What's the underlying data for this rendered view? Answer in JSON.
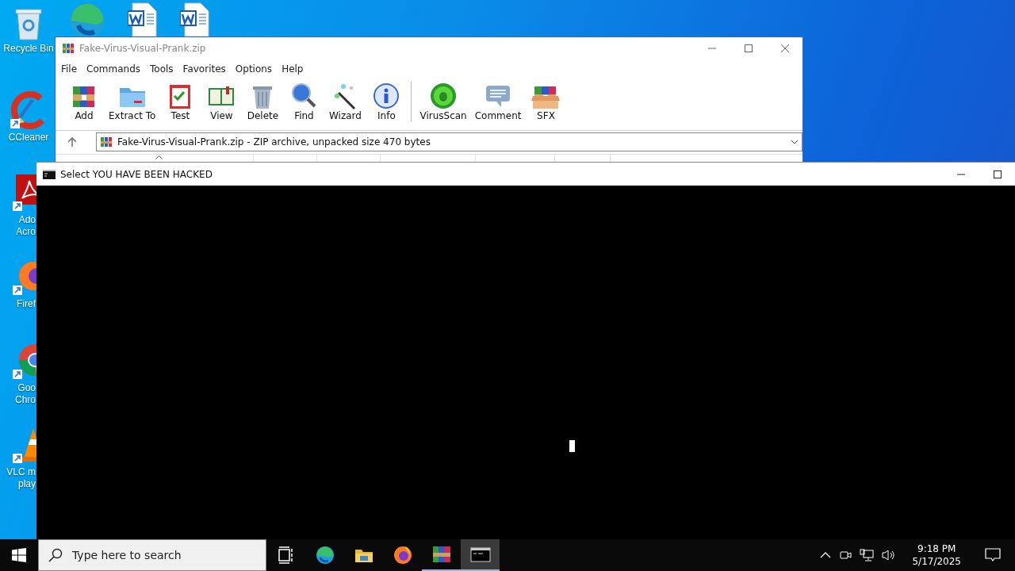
{
  "desktop_icons": [
    {
      "kind": "recycle",
      "lines": [
        "Recycle Bin"
      ]
    },
    {
      "kind": "ccleaner",
      "lines": [
        "CCleaner"
      ]
    },
    {
      "kind": "acrobat",
      "lines": [
        "Ado",
        "Acro"
      ]
    },
    {
      "kind": "firefox",
      "lines": [
        "Firef"
      ]
    },
    {
      "kind": "chrome",
      "lines": [
        "Goo",
        "Chro"
      ]
    },
    {
      "kind": "vlc",
      "lines": [
        "VLC m",
        "play"
      ]
    }
  ],
  "top_icons": [
    {
      "kind": "edge"
    },
    {
      "kind": "word"
    },
    {
      "kind": "word"
    }
  ],
  "archiver": {
    "title": "Fake-Virus-Visual-Prank.zip",
    "menu": [
      "File",
      "Commands",
      "Tools",
      "Favorites",
      "Options",
      "Help"
    ],
    "toolbar": [
      {
        "kind": "add",
        "label": "Add"
      },
      {
        "kind": "extract",
        "label": "Extract To"
      },
      {
        "kind": "test",
        "label": "Test"
      },
      {
        "kind": "view",
        "label": "View"
      },
      {
        "kind": "delete",
        "label": "Delete"
      },
      {
        "kind": "find",
        "label": "Find"
      },
      {
        "kind": "wizard",
        "label": "Wizard"
      },
      {
        "kind": "info",
        "label": "Info"
      },
      {
        "kind": "separator"
      },
      {
        "kind": "virusscan",
        "label": "VirusScan"
      },
      {
        "kind": "comment",
        "label": "Comment"
      },
      {
        "kind": "sfx",
        "label": "SFX"
      }
    ],
    "address": "Fake-Virus-Visual-Prank.zip - ZIP archive, unpacked size 470 bytes"
  },
  "console": {
    "title": "Select YOU HAVE BEEN HACKED"
  },
  "taskbar": {
    "search_placeholder": "Type here to search",
    "apps": [
      {
        "kind": "taskview",
        "running": false,
        "selected": false
      },
      {
        "kind": "edge",
        "running": false,
        "selected": false
      },
      {
        "kind": "explorer",
        "running": false,
        "selected": false
      },
      {
        "kind": "firefox",
        "running": false,
        "selected": false
      },
      {
        "kind": "winrar",
        "running": true,
        "selected": false
      },
      {
        "kind": "console",
        "running": true,
        "selected": true
      }
    ],
    "time": "9:18 PM",
    "date": "5/17/2025"
  }
}
